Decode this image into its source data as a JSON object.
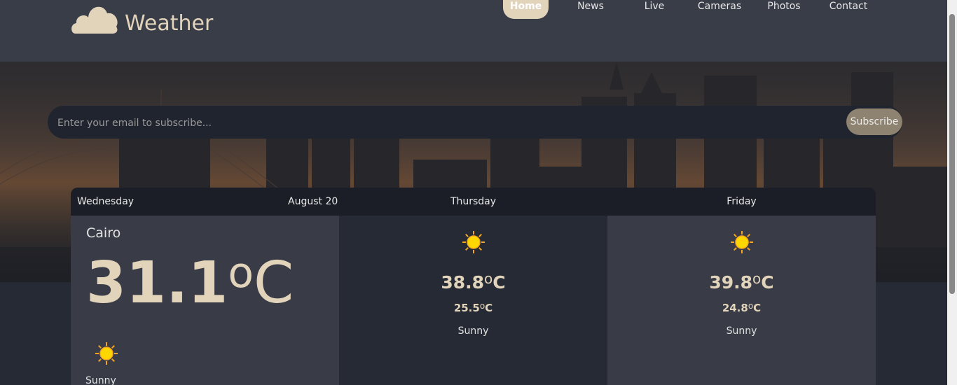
{
  "header": {
    "app_name": "Weather",
    "nav": [
      {
        "label": "Home",
        "active": true
      },
      {
        "label": "News",
        "active": false
      },
      {
        "label": "Live",
        "active": false
      },
      {
        "label": "Cameras",
        "active": false
      },
      {
        "label": "Photos",
        "active": false
      },
      {
        "label": "Contact",
        "active": false
      }
    ]
  },
  "subscribe": {
    "placeholder": "Enter your email to subscribe...",
    "button_label": "Subscribe"
  },
  "forecast": {
    "today": {
      "day": "Wednesday",
      "date": "August 20",
      "city": "Cairo",
      "temp": "31.1",
      "deg_symbol": "o",
      "unit": "C",
      "icon": "sun-icon",
      "condition": "Sunny"
    },
    "days": [
      {
        "day": "Thursday",
        "max": "38.8",
        "min": "25.5",
        "deg_symbol": "o",
        "unit": "C",
        "icon": "sun-icon",
        "condition": "Sunny"
      },
      {
        "day": "Friday",
        "max": "39.8",
        "min": "24.8",
        "deg_symbol": "o",
        "unit": "C",
        "icon": "sun-icon",
        "condition": "Sunny"
      }
    ]
  },
  "colors": {
    "accent": "#e2d3bb",
    "header_bg": "#393d48",
    "card_dark": "#252a35",
    "card_light": "#393c46",
    "subscribe_button": "#8e8270"
  }
}
